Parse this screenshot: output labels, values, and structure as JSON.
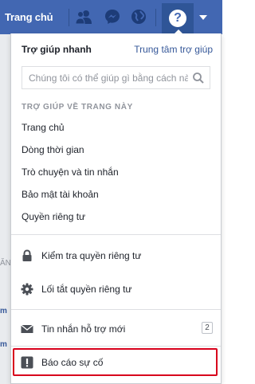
{
  "topbar": {
    "home_label": "Trang chủ",
    "icons": [
      "friends-icon",
      "messenger-icon",
      "globe-icon",
      "help-icon",
      "caret-down-icon"
    ],
    "help_symbol": "?"
  },
  "left_strip": {
    "fragments": [
      "ĂN",
      "m",
      "m"
    ]
  },
  "dropdown": {
    "title": "Trợ giúp nhanh",
    "help_center_link": "Trung tâm trợ giúp",
    "search": {
      "placeholder": "Chúng tôi có thể giúp gì bằng cách nào?",
      "value": ""
    },
    "section_heading": "TRỢ GIÚP VỀ TRANG NÀY",
    "topics": [
      "Trang chủ",
      "Dòng thời gian",
      "Trò chuyện và tin nhắn",
      "Bảo mật tài khoản",
      "Quyền riêng tư"
    ],
    "actions": [
      {
        "label": "Kiểm tra quyền riêng tư",
        "icon": "lock-icon"
      },
      {
        "label": "Lối tắt quyền riêng tư",
        "icon": "gear-icon"
      },
      {
        "label": "Tin nhắn hỗ trợ mới",
        "icon": "envelope-icon",
        "count": "2"
      },
      {
        "label": "Báo cáo sự cố",
        "icon": "alert-icon",
        "highlighted": true
      }
    ]
  },
  "colors": {
    "brand": "#4267b2",
    "link": "#365899",
    "highlight": "#d8001c"
  }
}
